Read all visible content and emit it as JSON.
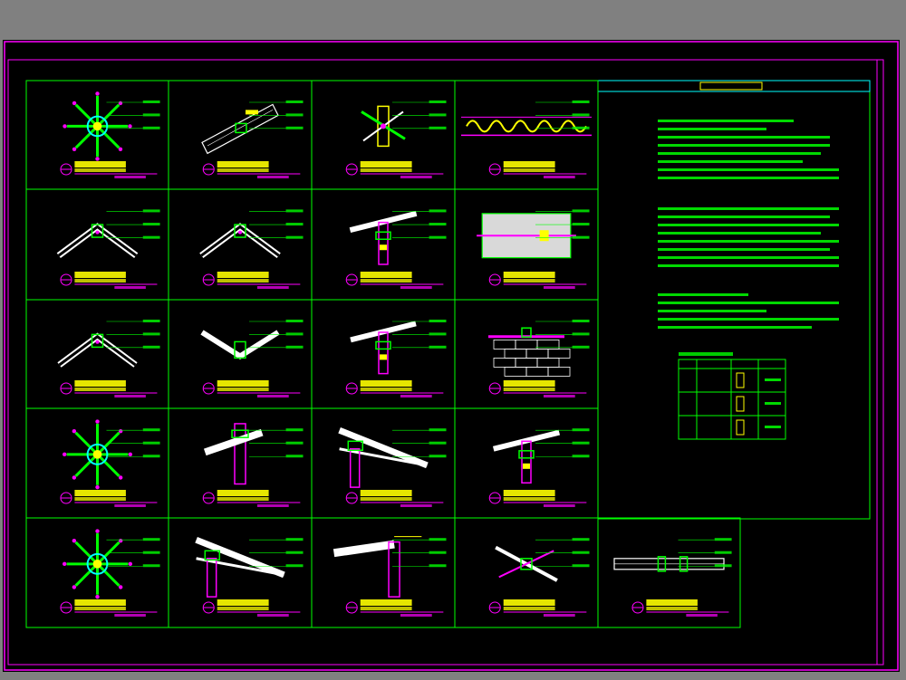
{
  "colors": {
    "background": "#808080",
    "sheet": "#000000",
    "border": "#ff00ff",
    "grid": "#00ffff",
    "title": "#ffff00",
    "annotation": "#00ff00",
    "accent": "#ff00ff",
    "wood": "#ffffff"
  },
  "notes": {
    "heading": "",
    "sections": [
      {
        "title": "",
        "lines": [
          "",
          "",
          "",
          "",
          ""
        ]
      },
      {
        "title": "",
        "lines": [
          "",
          "",
          ""
        ]
      },
      {
        "title": "",
        "lines": [
          "",
          "",
          ""
        ]
      }
    ]
  },
  "schedule": {
    "headers": [
      "",
      "",
      "",
      ""
    ],
    "rows": [
      {
        "mark": "",
        "size": "",
        "note": ""
      },
      {
        "mark": "",
        "size": "",
        "note": ""
      },
      {
        "mark": "",
        "size": "",
        "note": ""
      }
    ]
  },
  "details": [
    {
      "id": "d1",
      "kind": "hub",
      "title": "",
      "subtitle": "",
      "scale": ""
    },
    {
      "id": "d2",
      "kind": "slope",
      "title": "",
      "subtitle": "",
      "scale": ""
    },
    {
      "id": "d3",
      "kind": "bracket",
      "title": "",
      "subtitle": "",
      "scale": ""
    },
    {
      "id": "d4",
      "kind": "wave",
      "title": "",
      "subtitle": "",
      "scale": ""
    },
    {
      "id": "d5",
      "kind": "ridge",
      "title": "",
      "subtitle": "",
      "scale": ""
    },
    {
      "id": "d6",
      "kind": "ridge",
      "title": "",
      "subtitle": "",
      "scale": ""
    },
    {
      "id": "d7",
      "kind": "post",
      "title": "",
      "subtitle": "",
      "scale": ""
    },
    {
      "id": "d8",
      "kind": "concrete",
      "title": "",
      "subtitle": "",
      "scale": ""
    },
    {
      "id": "d9",
      "kind": "ridge",
      "title": "",
      "subtitle": "",
      "scale": ""
    },
    {
      "id": "d10",
      "kind": "valley",
      "title": "",
      "subtitle": "",
      "scale": ""
    },
    {
      "id": "d11",
      "kind": "post",
      "title": "",
      "subtitle": "",
      "scale": ""
    },
    {
      "id": "d12",
      "kind": "masonry",
      "title": "",
      "subtitle": "",
      "scale": ""
    },
    {
      "id": "d13",
      "kind": "hub",
      "title": "",
      "subtitle": "",
      "scale": ""
    },
    {
      "id": "d14",
      "kind": "column",
      "title": "",
      "subtitle": "",
      "scale": ""
    },
    {
      "id": "d15",
      "kind": "truss",
      "title": "",
      "subtitle": "",
      "scale": ""
    },
    {
      "id": "d16",
      "kind": "post",
      "title": "",
      "subtitle": "",
      "scale": ""
    },
    {
      "id": "d17",
      "kind": "hub",
      "title": "",
      "subtitle": "",
      "scale": ""
    },
    {
      "id": "d18",
      "kind": "truss",
      "title": "",
      "subtitle": "",
      "scale": ""
    },
    {
      "id": "d19",
      "kind": "eave",
      "title": "",
      "subtitle": "",
      "scale": ""
    },
    {
      "id": "d20",
      "kind": "cross",
      "title": "",
      "subtitle": "",
      "scale": ""
    },
    {
      "id": "d21",
      "kind": "beam",
      "title": "",
      "subtitle": "",
      "scale": ""
    }
  ]
}
